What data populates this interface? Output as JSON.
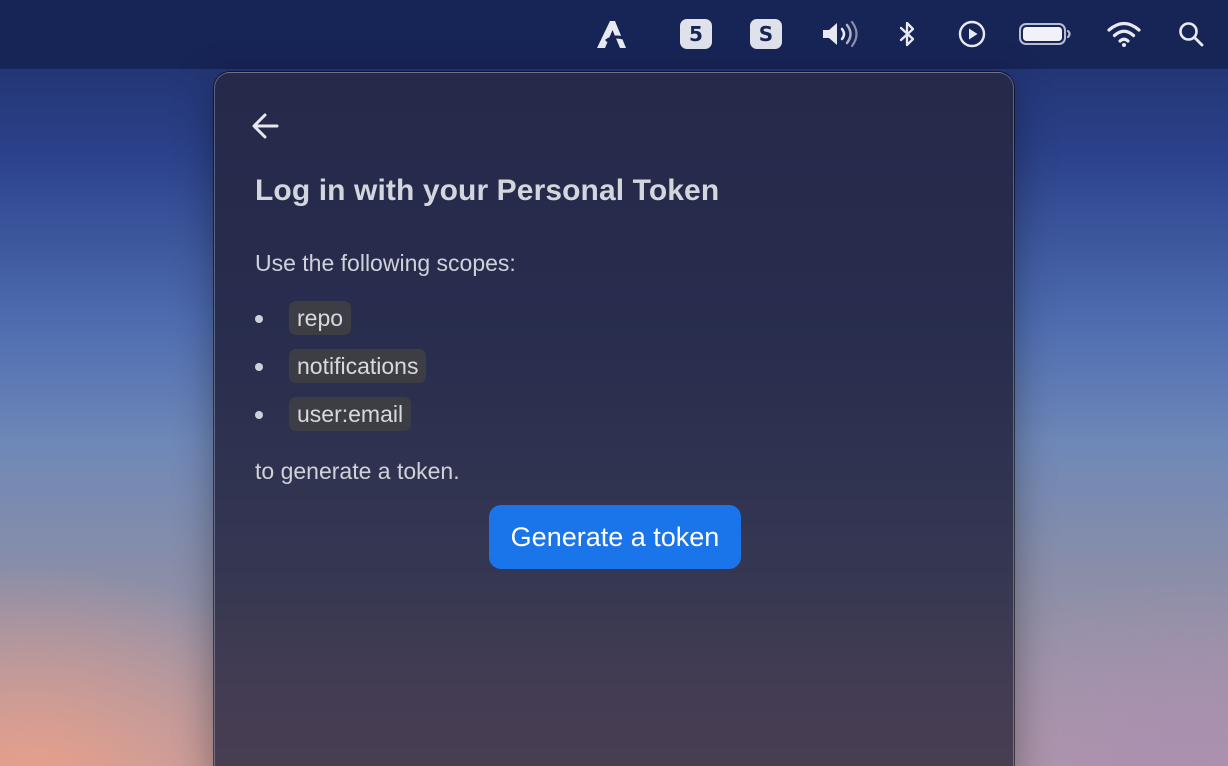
{
  "menubar": {
    "icons": [
      {
        "name": "app-a-icon",
        "badge": null
      },
      {
        "name": "badge-5-icon",
        "badge": "5"
      },
      {
        "name": "badge-s-icon",
        "badge": "S"
      },
      {
        "name": "volume-icon",
        "badge": null
      },
      {
        "name": "bluetooth-icon",
        "badge": null
      },
      {
        "name": "play-icon",
        "badge": null
      },
      {
        "name": "battery-icon",
        "badge": null
      },
      {
        "name": "wifi-icon",
        "badge": null
      },
      {
        "name": "search-icon",
        "badge": null
      }
    ]
  },
  "panel": {
    "back_icon": "arrow-left-icon",
    "title": "Log in with your Personal Token",
    "intro": "Use the following scopes:",
    "scopes": [
      "repo",
      "notifications",
      "user:email"
    ],
    "outro": "to generate a token.",
    "generate_button": "Generate a token"
  },
  "colors": {
    "accent": "#1a74ea",
    "menubar": "#172456",
    "panel": "#282d4e",
    "code_bg": "#3d3d45"
  }
}
